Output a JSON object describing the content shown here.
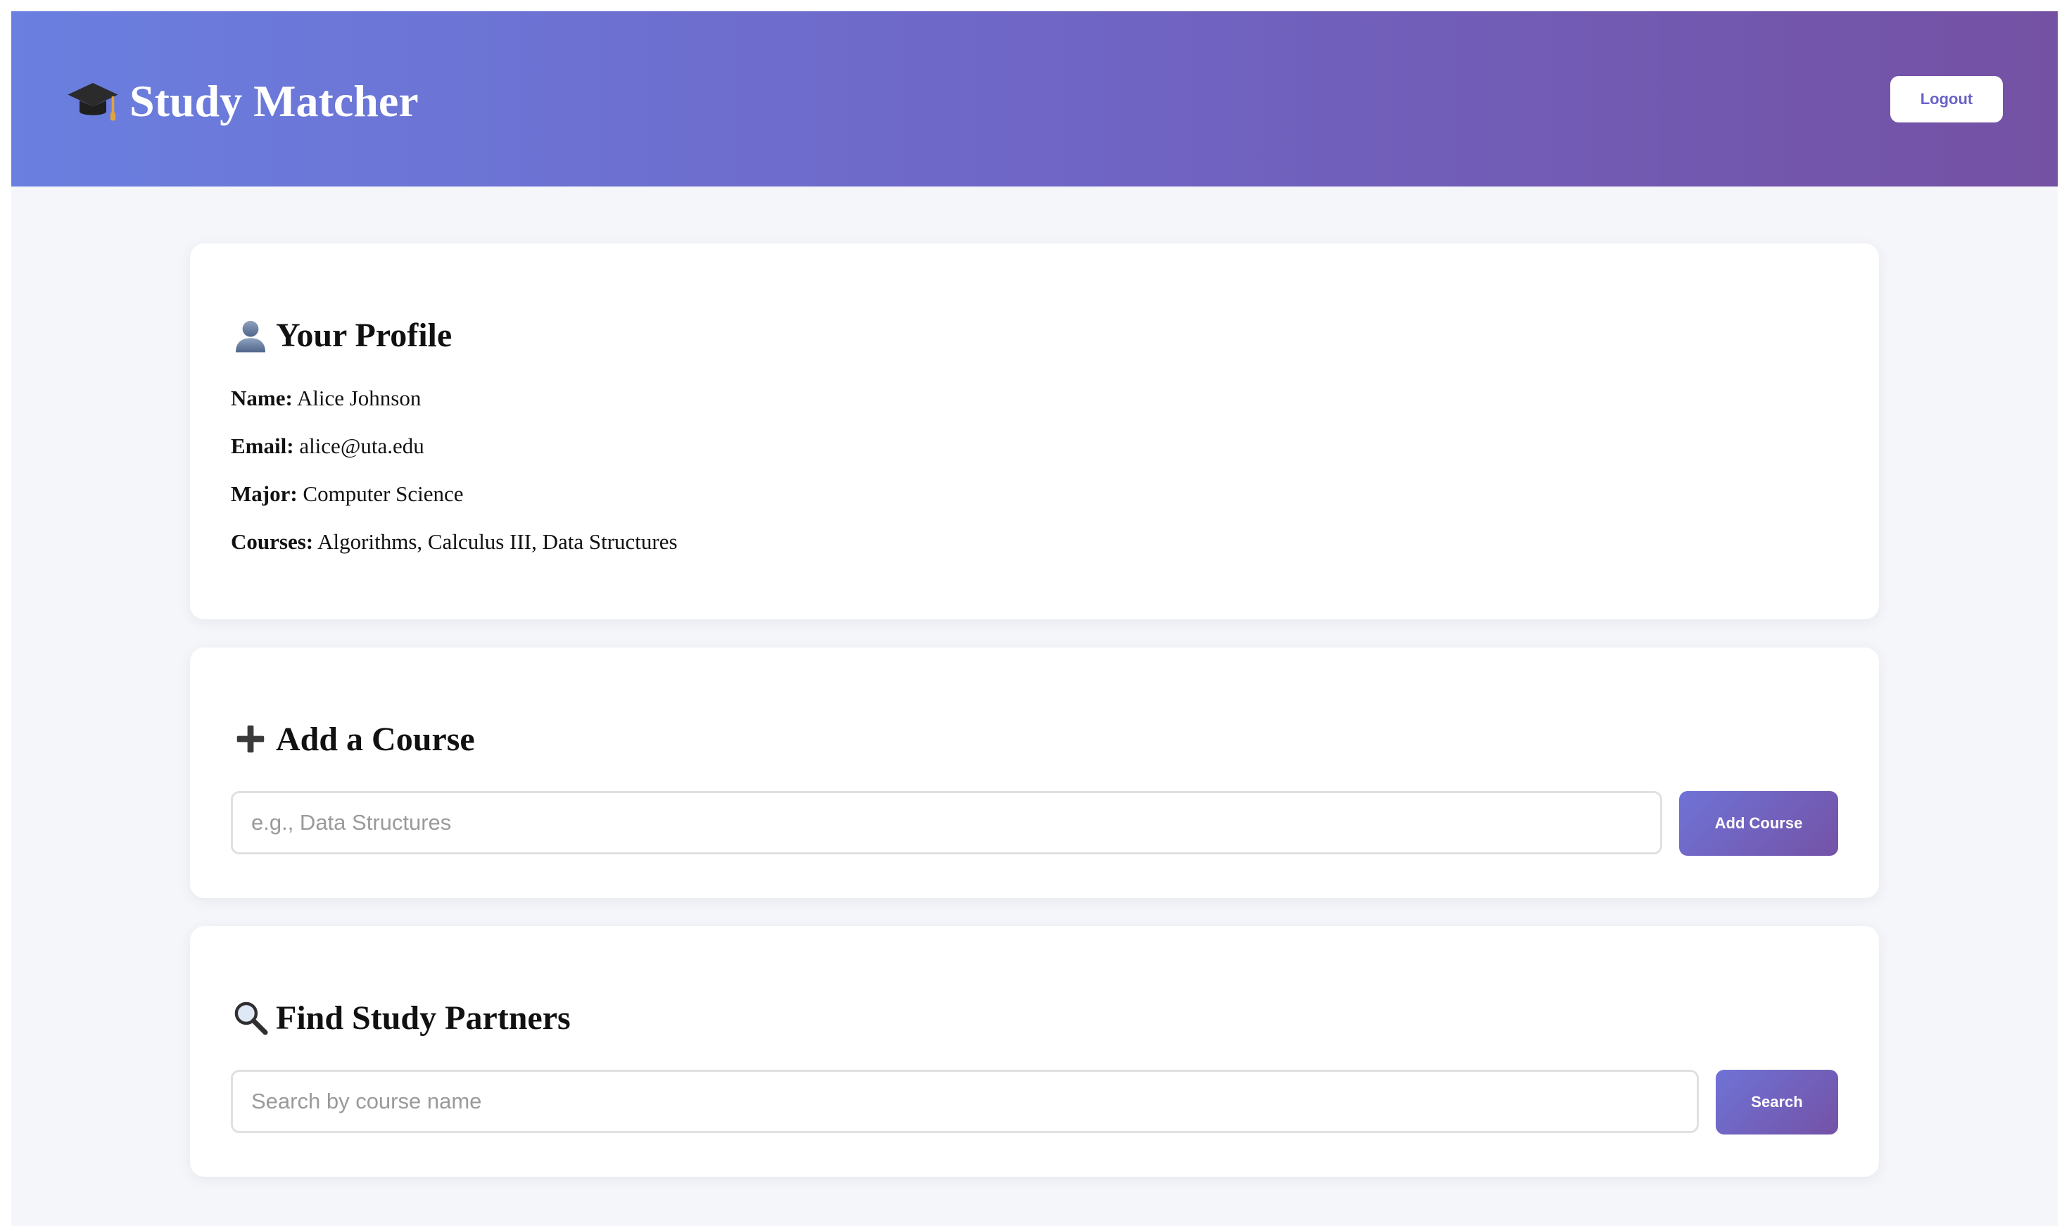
{
  "header": {
    "title": "Study Matcher",
    "logout_label": "Logout"
  },
  "profile": {
    "heading": "Your Profile",
    "name_label": "Name:",
    "name_value": "Alice Johnson",
    "email_label": "Email:",
    "email_value": "alice@uta.edu",
    "major_label": "Major:",
    "major_value": "Computer Science",
    "courses_label": "Courses:",
    "courses_value": "Algorithms, Calculus III, Data Structures"
  },
  "add_course": {
    "heading": "Add a Course",
    "input_value": "",
    "placeholder": "e.g., Data Structures",
    "button_label": "Add Course"
  },
  "find_partners": {
    "heading": "Find Study Partners",
    "input_value": "",
    "placeholder": "Search by course name",
    "button_label": "Search"
  },
  "icons": {
    "brand": "graduation-cap-icon",
    "profile": "user-silhouette-icon",
    "add_course": "plus-icon",
    "find_partners": "magnifying-glass-icon"
  },
  "colors": {
    "header_gradient_start": "#6a7fe0",
    "header_gradient_end": "#7451a3",
    "button_gradient_start": "#6f73d6",
    "button_gradient_end": "#7452a6",
    "page_background": "#f5f6fa",
    "logout_text": "#6a63c8"
  }
}
